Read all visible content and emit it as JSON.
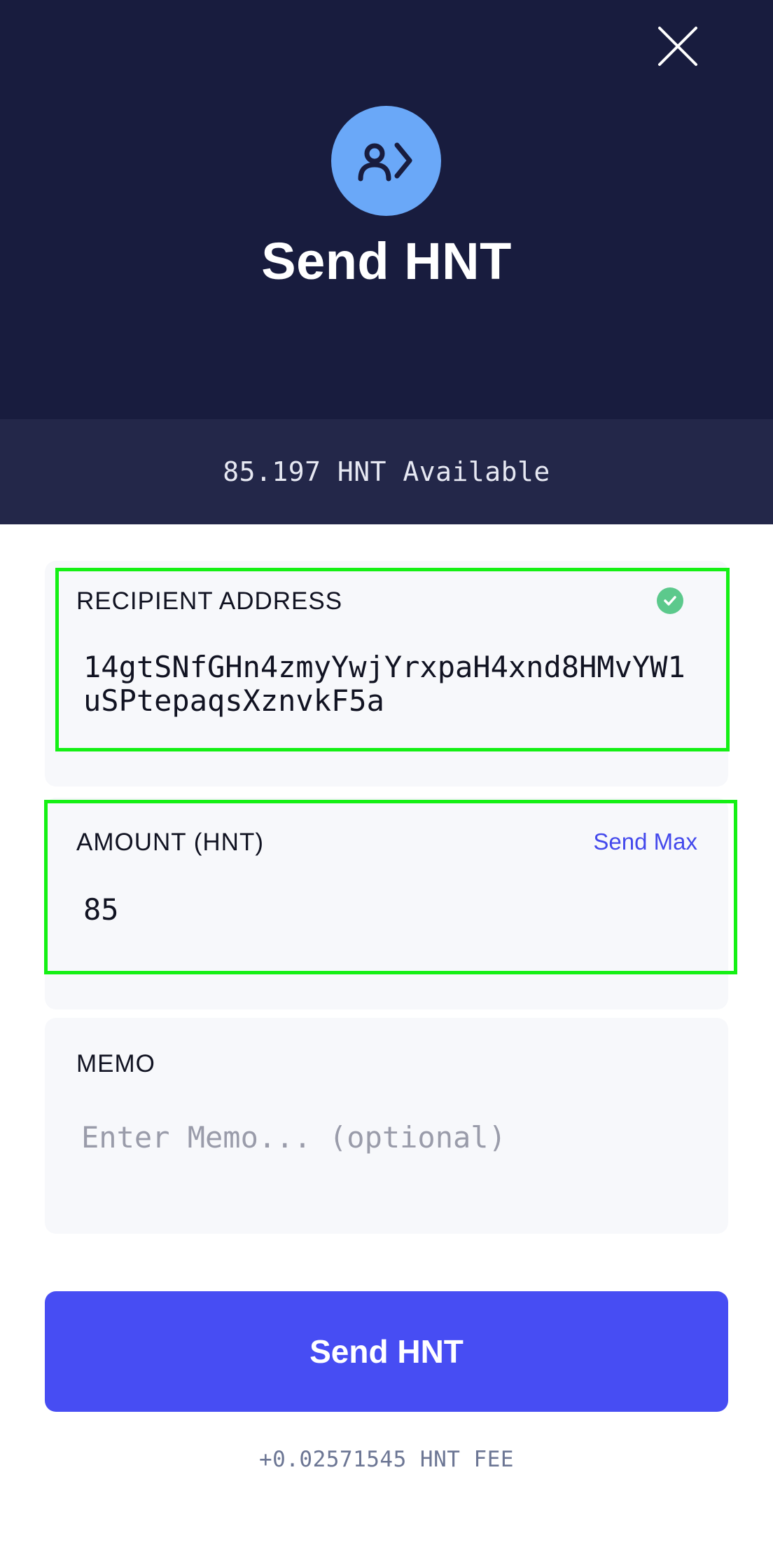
{
  "header": {
    "title": "Send HNT",
    "close_icon": "close-icon",
    "avatar_icon": "send-to-user-icon"
  },
  "balance": {
    "text": "85.197 HNT Available"
  },
  "recipient": {
    "label": "RECIPIENT ADDRESS",
    "value": "14gtSNfGHn4zmyYwjYrxpaH4xnd8HMvYW1uSPtepaqsXznvkF5a",
    "status_icon": "check-circle-icon"
  },
  "amount": {
    "label": "AMOUNT (HNT)",
    "send_max_label": "Send Max",
    "value": "85"
  },
  "memo": {
    "label": "MEMO",
    "placeholder": "Enter Memo... (optional)",
    "value": ""
  },
  "actions": {
    "send_label": "Send HNT"
  },
  "fee": {
    "text": "+0.02571545 HNT FEE"
  },
  "colors": {
    "header_bg": "#181c3e",
    "strip_bg": "#232749",
    "accent": "#474df3",
    "avatar": "#6aa8f8",
    "success": "#5cc98c",
    "highlight": "#14f014"
  }
}
